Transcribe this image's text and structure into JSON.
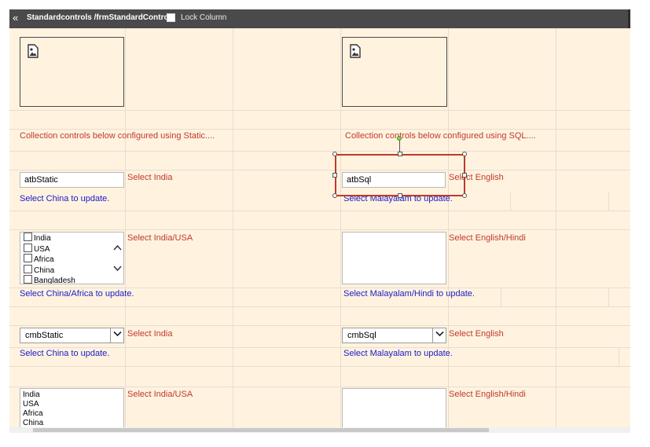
{
  "header": {
    "back_glyph": "«",
    "title": "Standardcontrols /frmStandardControl",
    "lock_label": "Lock Column"
  },
  "left": {
    "caption": "Collection controls below configured using Static....",
    "autocomplete": {
      "value": "atbStatic",
      "hint": "Select India",
      "note": "Select China to update."
    },
    "checklist": {
      "items": [
        "India",
        "USA",
        "Africa",
        "China",
        "Bangladesh"
      ],
      "hint": "Select India/USA",
      "note": "Select China/Africa to update."
    },
    "combo": {
      "value": "cmbStatic",
      "hint": "Select India",
      "note": "Select China to update."
    },
    "listbox": {
      "items": [
        "India",
        "USA",
        "Africa",
        "China"
      ],
      "hint": "Select India/USA"
    }
  },
  "right": {
    "caption": "Collection controls below configured using SQL....",
    "autocomplete": {
      "value": "atbSql",
      "hint": "Select English",
      "note": "Select Malayalam to update."
    },
    "checklist": {
      "hint": "Select English/Hindi",
      "note": "Select Malayalam/Hindi to update."
    },
    "combo": {
      "value": "cmbSql",
      "hint": "Select English",
      "note": "Select Malayalam to update."
    },
    "listbox": {
      "hint": "Select English/Hindi"
    }
  },
  "icons": {
    "image_placeholder": "image-placeholder-icon",
    "scroll_up": "chevron-up-icon",
    "scroll_down": "chevron-down-icon",
    "dropdown": "chevron-down-icon"
  },
  "colors": {
    "caption_red": "#c0392b",
    "note_blue": "#1a1ac8",
    "canvas": "#fff3e0",
    "selection": "#c0392b"
  }
}
